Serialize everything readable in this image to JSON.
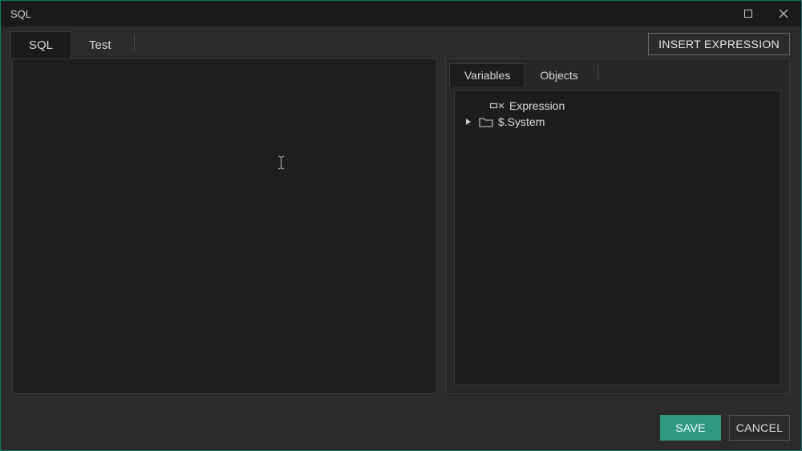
{
  "window": {
    "title": "SQL"
  },
  "buttons": {
    "insert_expression": "INSERT EXPRESSION",
    "save": "SAVE",
    "cancel": "CANCEL"
  },
  "main_tabs": [
    {
      "label": "SQL",
      "active": true
    },
    {
      "label": "Test",
      "active": false
    }
  ],
  "side_tabs": [
    {
      "label": "Variables",
      "active": true
    },
    {
      "label": "Objects",
      "active": false
    }
  ],
  "tree": [
    {
      "label": "Expression",
      "icon": "expression",
      "expandable": false,
      "indent": 1
    },
    {
      "label": "$.System",
      "icon": "folder",
      "expandable": true,
      "indent": 0
    }
  ],
  "editor": {
    "value": ""
  }
}
